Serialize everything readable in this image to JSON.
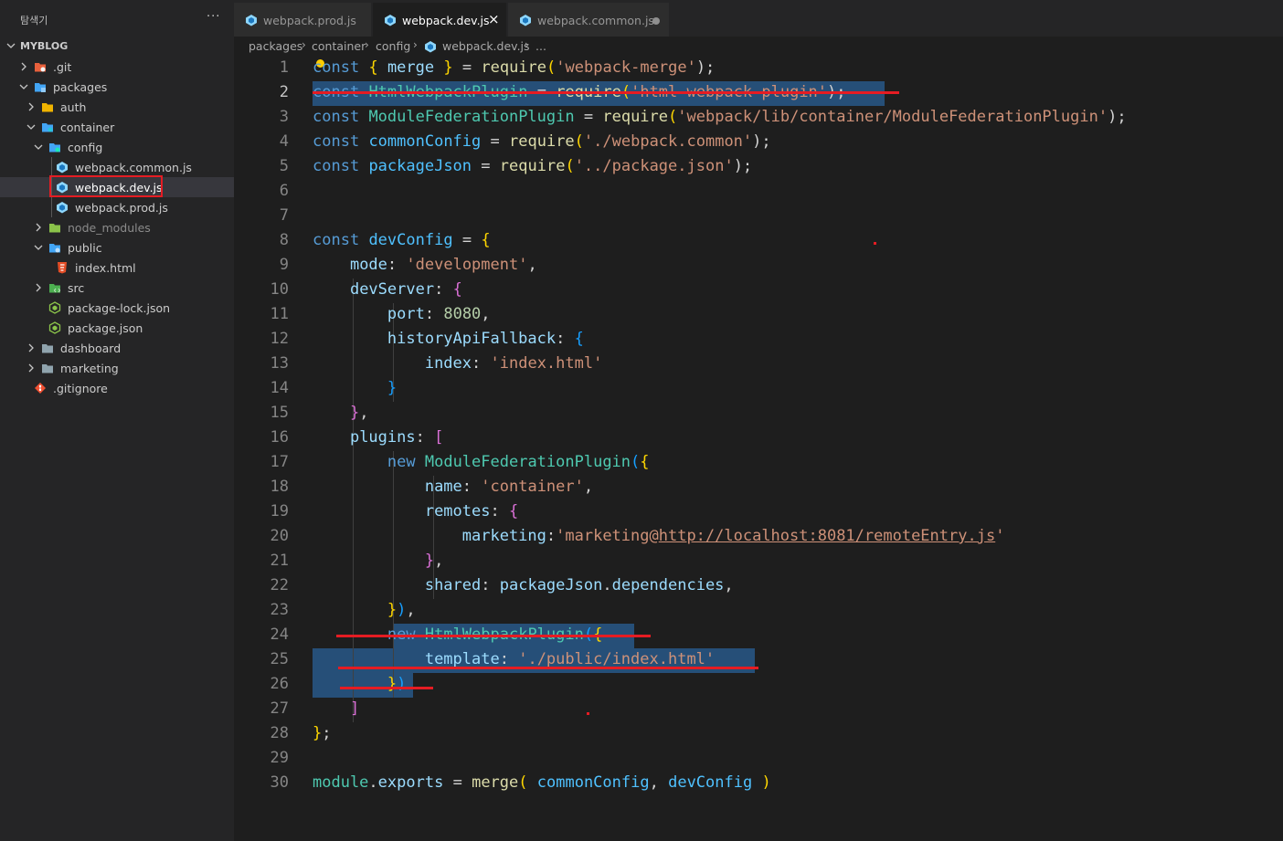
{
  "sidebar": {
    "title": "탐색기",
    "more": "···",
    "root": "MYBLOG",
    "items": [
      {
        "label": ".git",
        "icon": "git-folder-icon"
      },
      {
        "label": "packages",
        "icon": "packages-folder-icon"
      },
      {
        "label": "auth",
        "icon": "folder-icon"
      },
      {
        "label": "container",
        "icon": "folder-icon"
      },
      {
        "label": "config",
        "icon": "config-folder-icon"
      },
      {
        "label": "webpack.common.js",
        "icon": "webpack-icon"
      },
      {
        "label": "webpack.dev.js",
        "icon": "webpack-icon"
      },
      {
        "label": "webpack.prod.js",
        "icon": "webpack-icon"
      },
      {
        "label": "node_modules",
        "icon": "node-folder-icon"
      },
      {
        "label": "public",
        "icon": "public-folder-icon"
      },
      {
        "label": "index.html",
        "icon": "html5-icon"
      },
      {
        "label": "src",
        "icon": "src-folder-icon"
      },
      {
        "label": "package-lock.json",
        "icon": "nodejs-icon"
      },
      {
        "label": "package.json",
        "icon": "nodejs-icon"
      },
      {
        "label": "dashboard",
        "icon": "folder-icon"
      },
      {
        "label": "marketing",
        "icon": "folder-icon"
      },
      {
        "label": ".gitignore",
        "icon": "git-icon"
      }
    ]
  },
  "tabs": [
    {
      "label": "webpack.prod.js"
    },
    {
      "label": "webpack.dev.js",
      "close": "×"
    },
    {
      "label": "webpack.common.js"
    }
  ],
  "breadcrumb": {
    "parts": [
      "packages",
      "container",
      "config",
      "webpack.dev.js",
      "..."
    ],
    "sep": "›"
  },
  "editor": {
    "line_numbers": [
      "1",
      "2",
      "3",
      "4",
      "5",
      "6",
      "7",
      "8",
      "9",
      "10",
      "11",
      "12",
      "13",
      "14",
      "15",
      "16",
      "17",
      "18",
      "19",
      "20",
      "21",
      "22",
      "23",
      "24",
      "25",
      "26",
      "27",
      "28",
      "29",
      "30"
    ],
    "active_line": "2",
    "code": {
      "l1": [
        "const",
        "{",
        "merge",
        "}",
        "=",
        "require",
        "(",
        "'webpack-merge'",
        ");"
      ],
      "l2": [
        "const",
        "HtmlWebpackPlugin",
        "=",
        "require",
        "(",
        "'html-webpack-plugin'",
        ");"
      ],
      "l3": [
        "const",
        "ModuleFederationPlugin",
        "=",
        "require",
        "(",
        "'webpack/lib/container/ModuleFederationPlugin'",
        ");"
      ],
      "l4": [
        "const",
        "commonConfig",
        "=",
        "require",
        "(",
        "'./webpack.common'",
        ");"
      ],
      "l5": [
        "const",
        "packageJson",
        "=",
        "require",
        "(",
        "'../package.json'",
        ");"
      ],
      "l8": [
        "const",
        "devConfig",
        "=",
        "{"
      ],
      "l9": [
        "mode",
        ":",
        "'development'",
        ","
      ],
      "l10": [
        "devServer",
        ":",
        "{"
      ],
      "l11": [
        "port",
        ":",
        "8080",
        ","
      ],
      "l12": [
        "historyApiFallback",
        ":",
        "{"
      ],
      "l13": [
        "index",
        ":",
        "'index.html'"
      ],
      "l14": [
        "}"
      ],
      "l15": [
        "}",
        ","
      ],
      "l16": [
        "plugins",
        ":",
        "["
      ],
      "l17": [
        "new",
        "ModuleFederationPlugin",
        "(",
        "{"
      ],
      "l18": [
        "name",
        ":",
        "'container'",
        ","
      ],
      "l19": [
        "remotes",
        ":",
        "{"
      ],
      "l20": [
        "marketing",
        ":",
        "'marketing@",
        "http://localhost:8081/remoteEntry.js",
        "'"
      ],
      "l21": [
        "}",
        ","
      ],
      "l22": [
        "shared",
        ":",
        "packageJson",
        ".",
        "dependencies",
        ","
      ],
      "l23": [
        "}",
        ")",
        ","
      ],
      "l24": [
        "new",
        "HtmlWebpackPlugin",
        "(",
        "{"
      ],
      "l25": [
        "template",
        ":",
        "'./public/index.html'"
      ],
      "l26": [
        "}",
        ")"
      ],
      "l27": [
        "]"
      ],
      "l28": [
        "}",
        ";"
      ],
      "l30": [
        "module",
        ".",
        "exports",
        "=",
        "merge",
        "(",
        "commonConfig",
        ",",
        "devConfig",
        ")"
      ]
    }
  },
  "colors": {
    "keyword": "#569cd6",
    "string": "#ce9178",
    "class": "#4ec9b0",
    "function": "#dcdcaa",
    "property": "#9cdcfe",
    "number": "#b5cea8",
    "annotation_red": "#e51c23",
    "selection": "#264f78"
  }
}
